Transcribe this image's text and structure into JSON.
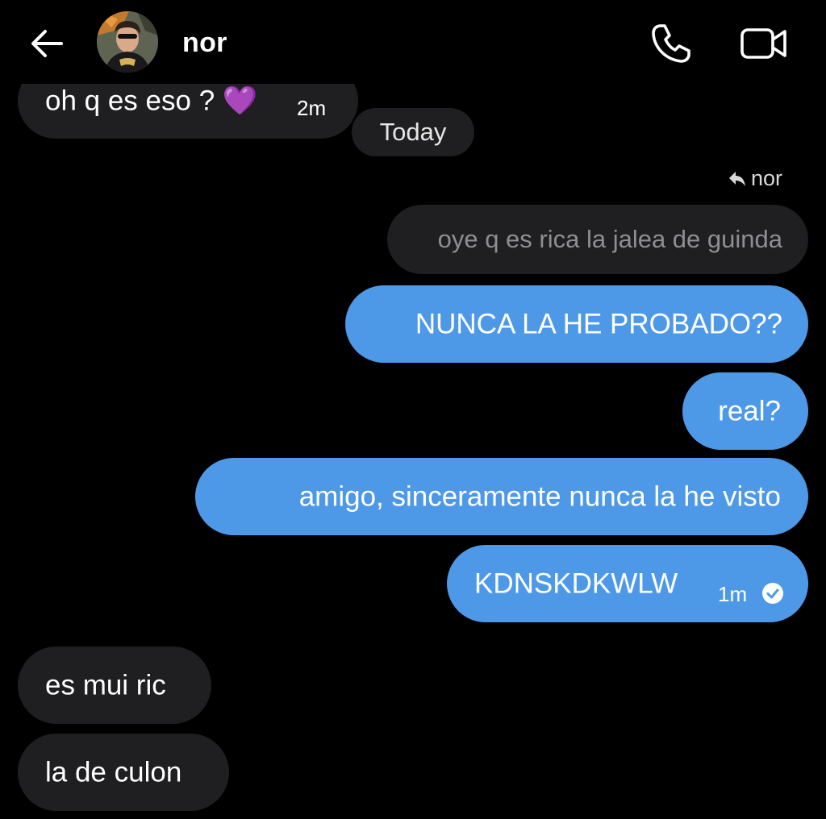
{
  "header": {
    "contact_name": "nor",
    "back_icon": "arrow-left-icon",
    "call_icon": "phone-icon",
    "video_icon": "video-camera-icon"
  },
  "messages": {
    "m1": {
      "text": "oh q es eso ? 💜",
      "time": "2m"
    },
    "date_separator": "Today",
    "reply_to": "nor",
    "quoted": "oye q es rica la jalea de guinda",
    "m2": {
      "text": "NUNCA LA HE PROBADO??"
    },
    "m3": {
      "text": "real?"
    },
    "m4": {
      "text": "amigo, sinceramente nunca la he visto"
    },
    "m5": {
      "text": "KDNSKDKWLW",
      "time": "1m"
    },
    "m6": {
      "text": "es mui ric"
    },
    "m7": {
      "text": "la de culon"
    }
  },
  "colors": {
    "background": "#000000",
    "incoming_bubble": "#1f1f21",
    "outgoing_bubble": "#4d99e8"
  }
}
